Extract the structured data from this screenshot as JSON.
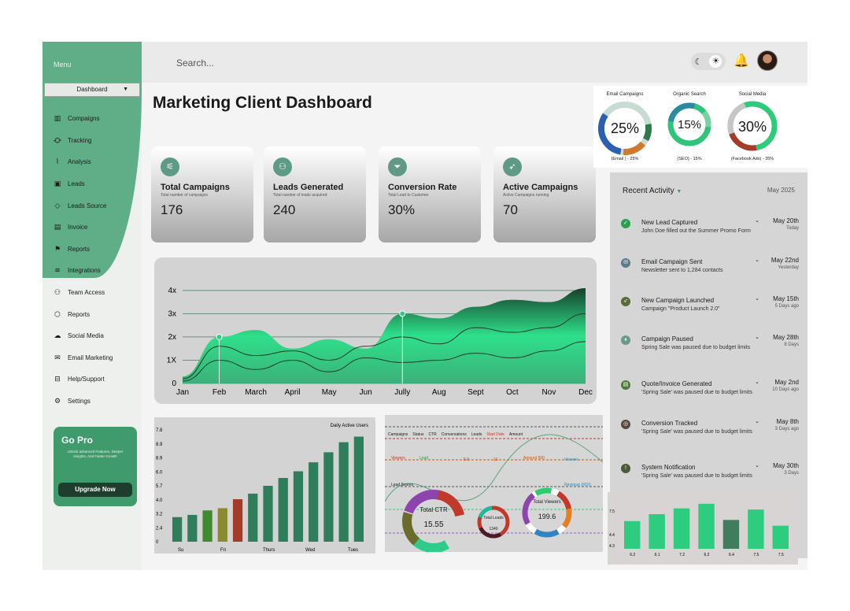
{
  "sidebar": {
    "menu_label": "Menu",
    "dropdown": "Dashboard",
    "items": [
      {
        "label": "Compaigns",
        "icon": "bar-chart-icon"
      },
      {
        "label": "Tracking",
        "icon": "route-icon"
      },
      {
        "label": "Analysis",
        "icon": "line-chart-icon"
      },
      {
        "label": "Leads",
        "icon": "square-icon"
      },
      {
        "label": "Leads Source",
        "icon": "diamond-icon"
      },
      {
        "label": "Invoice",
        "icon": "invoice-icon"
      },
      {
        "label": "Reports",
        "icon": "flag-icon"
      },
      {
        "label": "Integrations",
        "icon": "layers-icon"
      },
      {
        "label": "Team Access",
        "icon": "team-icon"
      },
      {
        "label": "Reports",
        "icon": "reports-icon"
      },
      {
        "label": "Social Media",
        "icon": "cloud-icon"
      },
      {
        "label": "Email Marketing",
        "icon": "mail-icon"
      },
      {
        "label": "Help/Support",
        "icon": "help-icon"
      },
      {
        "label": "Settings",
        "icon": "gear-icon"
      }
    ],
    "go_pro": {
      "title": "Go Pro",
      "title_accent": "Go Pro",
      "description": "Unlock advanced Features, Deeper Insights, And Faster Growth",
      "button": "Upgrade Now"
    }
  },
  "topbar": {
    "search_placeholder": "Search...",
    "theme_dark_icon": "moon-icon",
    "theme_light_icon": "sun-icon"
  },
  "page_title": "Marketing Client Dashboard",
  "kpis": [
    {
      "title": "Total Campaigns",
      "subtitle": "Total number of campaigns",
      "value": "176",
      "icon": "campaign-icon"
    },
    {
      "title": "Leads Generated",
      "subtitle": "Total number of leads acquired",
      "value": "240",
      "icon": "people-icon"
    },
    {
      "title": "Conversion Rate",
      "subtitle": "Total Lead to Customer",
      "value": "30%",
      "icon": "funnel-icon"
    },
    {
      "title": "Active Campaigns",
      "subtitle": "Active Campaigns running",
      "value": "70",
      "icon": "rocket-icon"
    }
  ],
  "donuts": [
    {
      "title": "Email Campaigns",
      "value": "25%",
      "caption": "(Email ) - 25%"
    },
    {
      "title": "Organic Search",
      "value": "15%",
      "caption": "(SEO) - 15%"
    },
    {
      "title": "Social Media",
      "value": "30%",
      "caption": "(Facebook Ads) - 35%"
    }
  ],
  "chart_data": [
    {
      "type": "area",
      "categories": [
        "Jan",
        "Feb",
        "March",
        "April",
        "May",
        "Jun",
        "Jully",
        "Aug",
        "Sept",
        "Oct",
        "Nov",
        "Dec"
      ],
      "y_ticks": [
        "0",
        "1X",
        "2x",
        "3x",
        "4x"
      ],
      "series": [
        {
          "values": [
            0.3,
            2.0,
            2.3,
            1.5,
            1.9,
            1.5,
            3.0,
            2.8,
            3.3,
            3.6,
            3.5,
            4.1
          ]
        },
        {
          "values": [
            0.2,
            1.6,
            1.2,
            1.4,
            1.0,
            1.6,
            2.0,
            1.7,
            2.4,
            2.2,
            2.4,
            3.0
          ]
        },
        {
          "values": [
            0.1,
            1.0,
            0.6,
            1.0,
            0.5,
            1.1,
            0.9,
            1.0,
            1.3,
            1.1,
            1.4,
            1.8
          ]
        }
      ],
      "ylim": [
        0,
        4.2
      ]
    },
    {
      "type": "bar",
      "title": "Daily Active Users",
      "y_ticks": [
        "0",
        "2.4",
        "3.2",
        "4.0",
        "5.7",
        "6.0",
        "8.9",
        "8.9",
        "7.8"
      ],
      "x_ticks": [
        "Su",
        "Fri",
        "Thurs",
        "Wed",
        "Tues"
      ],
      "values": [
        2.2,
        2.4,
        2.8,
        3.0,
        3.8,
        4.3,
        5.0,
        5.7,
        6.3,
        7.1,
        8.0,
        8.9,
        9.4
      ],
      "colors": [
        "#2e7d5b",
        "#2e7d5b",
        "#3f8a2e",
        "#8a8a2e",
        "#a33a2a",
        "#2e7d5b",
        "#2e7d5b",
        "#2e7d5b",
        "#2e7d5b",
        "#2e7d5b",
        "#2e7d5b",
        "#2e7d5b",
        "#2e7d5b"
      ],
      "ylim": [
        0,
        10
      ]
    },
    {
      "type": "bar",
      "y_ticks": [
        "7.5",
        "4.4",
        "4.3"
      ],
      "x_ticks": [
        "6.2",
        "6.1",
        "7.2",
        "6.2",
        "6.4",
        "7.5",
        "7.5"
      ],
      "values": [
        4.8,
        6.0,
        7.0,
        7.8,
        5.0,
        6.8,
        4.0
      ],
      "colors": [
        "#2ecc7f",
        "#2ecc7f",
        "#2ecc7f",
        "#2ecc7f",
        "#3f7d5e",
        "#2ecc7f",
        "#2ecc7f"
      ],
      "ylim": [
        0,
        9
      ]
    }
  ],
  "campaign_table": {
    "headers": [
      "Campaigns",
      "Status",
      "CTR",
      "Conversations",
      "Leads",
      "Start Date",
      "Amount"
    ],
    "row_labels": [
      "Viewers",
      "Lead",
      "5.0",
      "12",
      "Amount 500",
      "Viewers"
    ],
    "center_labels": [
      {
        "label": "Total CTR",
        "value": "15.55"
      },
      {
        "label": "Total Leads",
        "value": "1340"
      },
      {
        "label": "Total Viewers",
        "value": "199.6"
      }
    ],
    "side_labels": [
      "Lead Scores",
      "Revenue (ROI)"
    ]
  },
  "activity": {
    "title": "Recent Activity",
    "month": "May 2025",
    "items": [
      {
        "title": "New Lead Captured",
        "desc": "John Doe filled out the Summer Promo Form",
        "date": "May 20th",
        "ago": "Today",
        "color": "#2e9e4f",
        "icon": "check-icon"
      },
      {
        "title": "Email Campaign Sent",
        "desc": "Newsletter sent to 1,284 contacts",
        "date": "May 22nd",
        "ago": "Yesterday",
        "color": "#5b7a8a",
        "icon": "mail-icon"
      },
      {
        "title": "New Campaign Launched",
        "desc": "Campaign \"Product Launch 2.0\"",
        "date": "May 15th",
        "ago": "5 Days ago",
        "color": "#5a6b3a",
        "icon": "rocket-icon"
      },
      {
        "title": "Campaign Paused",
        "desc": "Spring Sale was paused due to budget limits",
        "date": "May 28th",
        "ago": "8 Days",
        "color": "#6a9a8a",
        "icon": "pause-icon"
      },
      {
        "title": "Quote/Invoice Generated",
        "desc": "'Spring Sale' was paused due to budget limits",
        "date": "May 2nd",
        "ago": "10 Days ago",
        "color": "#4f7a3a",
        "icon": "invoice-icon"
      },
      {
        "title": "Conversion Tracked",
        "desc": "'Spring Sale' was paused due to budget limits",
        "date": "May 8th",
        "ago": "3 Days ago",
        "color": "#5a4a3a",
        "icon": "target-icon"
      },
      {
        "title": "System Notification",
        "desc": "'Spring Sale' was paused due to budget limits",
        "date": "May 30th",
        "ago": "3 Days",
        "color": "#4a5a3a",
        "icon": "bell-icon"
      }
    ]
  }
}
